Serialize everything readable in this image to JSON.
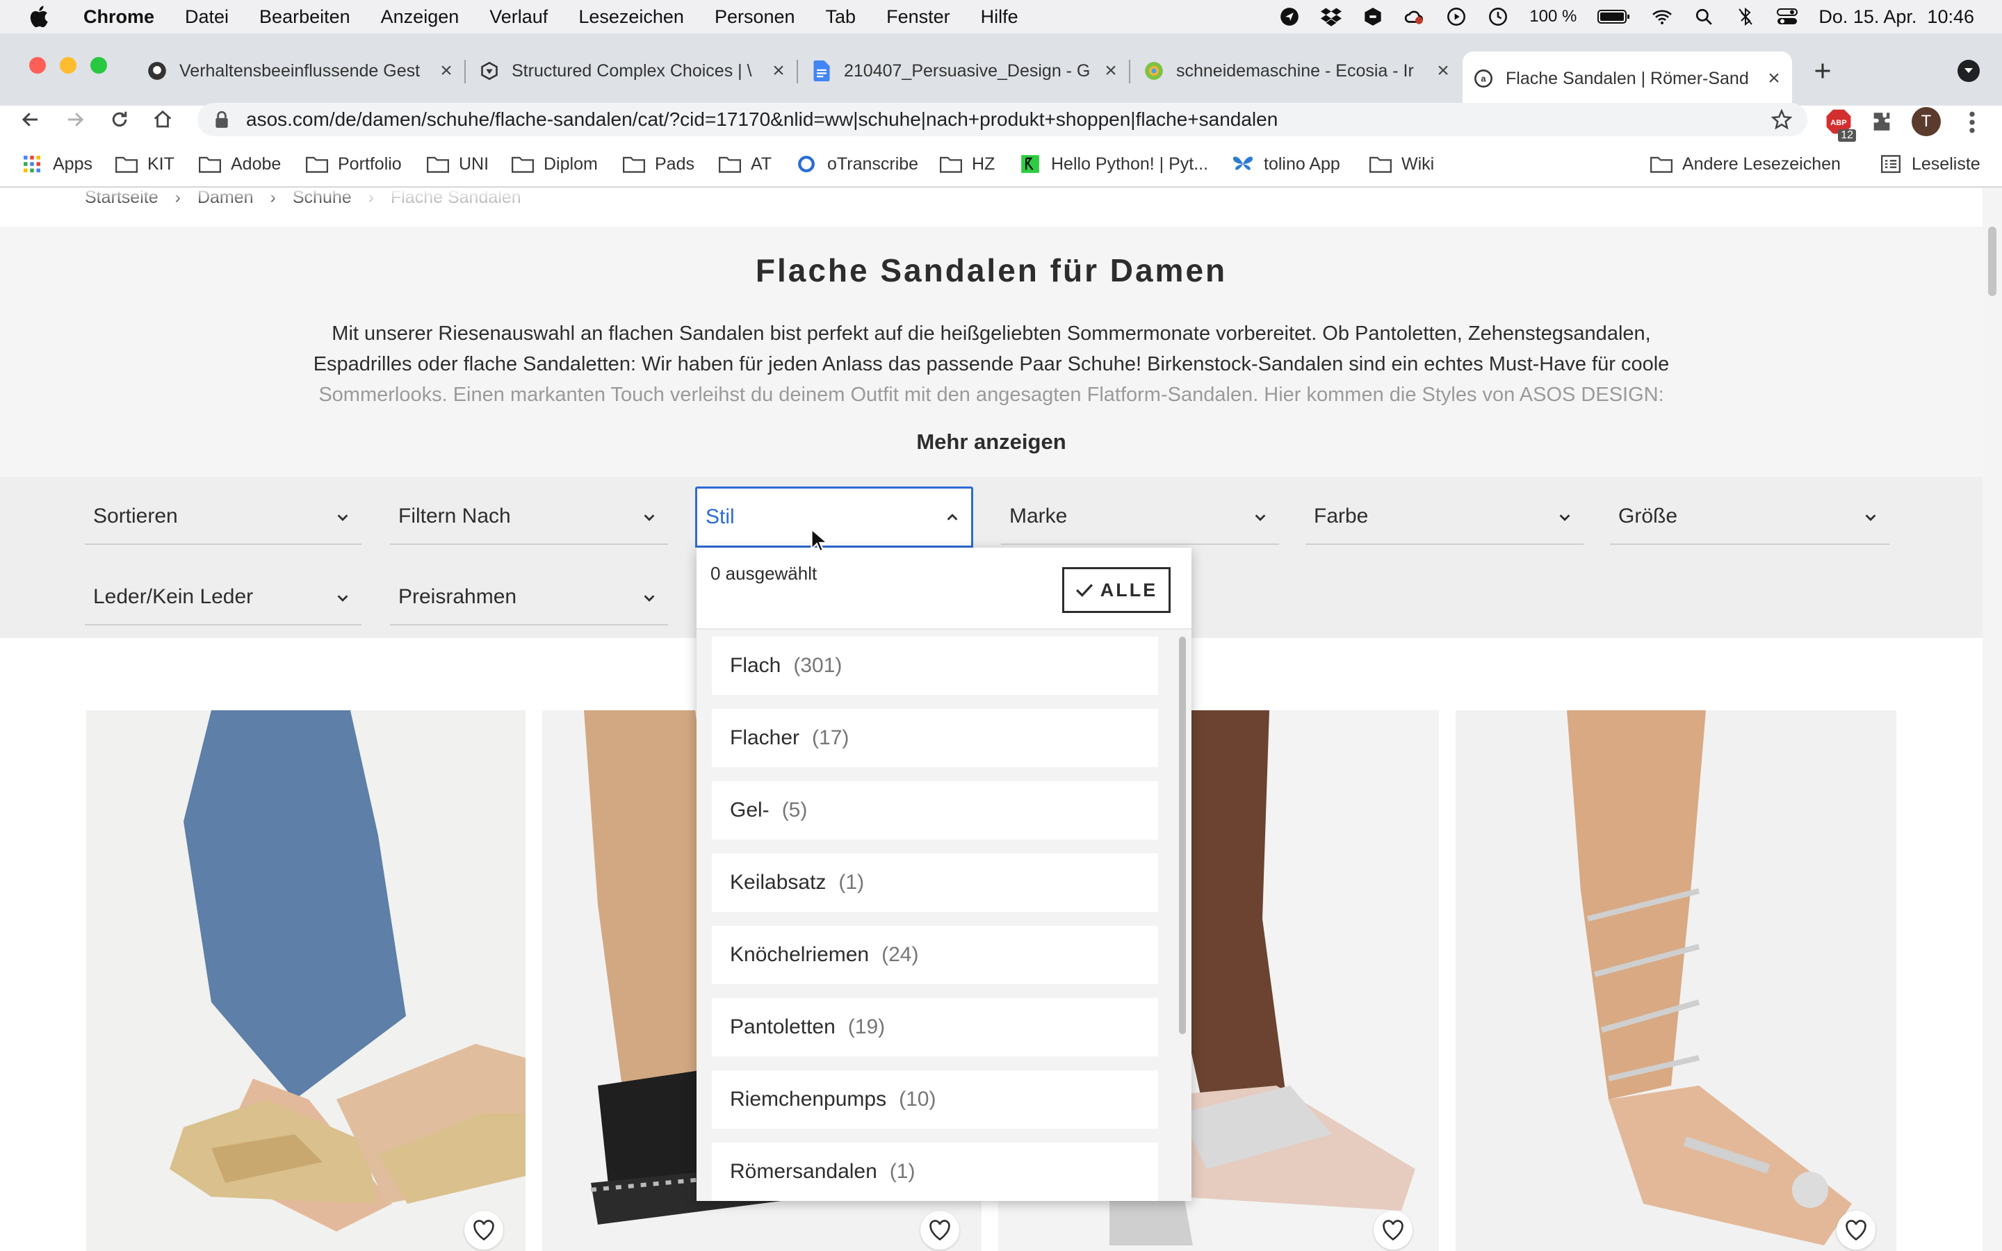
{
  "menubar": {
    "app": "Chrome",
    "items": [
      "Datei",
      "Bearbeiten",
      "Anzeigen",
      "Verlauf",
      "Lesezeichen",
      "Personen",
      "Tab",
      "Fenster",
      "Hilfe"
    ],
    "battery": "100 %",
    "datetime": "Do. 15. Apr.  10:46"
  },
  "tabs": [
    {
      "title": "Verhaltensbeeinflussende Gest",
      "icon": "github-icon"
    },
    {
      "title": "Structured Complex Choices | \\",
      "icon": "paper-icon"
    },
    {
      "title": "210407_Persuasive_Design - G",
      "icon": "docs-icon"
    },
    {
      "title": "schneidemaschine - Ecosia - Ir",
      "icon": "ecosia-icon"
    },
    {
      "title": "Flache Sandalen | Römer-Sand",
      "icon": "asos-icon",
      "active": true
    }
  ],
  "address": {
    "url": "asos.com/de/damen/schuhe/flache-sandalen/cat/?cid=17170&nlid=ww|schuhe|nach+produkt+shoppen|flache+sandalen",
    "extension_badge": "12",
    "profile_initial": "T"
  },
  "bookmarks": {
    "apps": "Apps",
    "items": [
      "KIT",
      "Adobe",
      "Portfolio",
      "UNI",
      "Diplom",
      "Pads",
      "AT",
      "oTranscribe",
      "HZ",
      "Hello Python! | Pyt...",
      "tolino App",
      "Wiki"
    ],
    "other": "Andere Lesezeichen",
    "reading_list": "Leseliste"
  },
  "breadcrumb": [
    "Startseite",
    "Damen",
    "Schuhe",
    "Flache Sandalen"
  ],
  "hero": {
    "title": "Flache Sandalen für Damen",
    "line1": "Mit unserer Riesenauswahl an flachen Sandalen bist perfekt auf die heißgeliebten Sommermonate vorbereitet. Ob Pantoletten, Zehenstegsandalen,",
    "line2": "Espadrilles oder flache Sandaletten: Wir haben für jeden Anlass das passende Paar Schuhe! Birkenstock-Sandalen sind ein echtes Must-Have für coole",
    "line3": "Sommerlooks. Einen markanten Touch verleihst du deinem Outfit mit den angesagten Flatform-Sandalen. Hier kommen die Styles von ASOS DESIGN:",
    "more": "Mehr anzeigen"
  },
  "filters": {
    "sort": "Sortieren",
    "filter_by": "Filtern Nach",
    "style": "Stil",
    "brand": "Marke",
    "color": "Farbe",
    "size": "Größe",
    "leather": "Leder/Kein Leder",
    "price": "Preisrahmen"
  },
  "dropdown": {
    "selected_count": "0 ausgewählt",
    "all_button": "ALLE",
    "options": [
      {
        "label": "Flach",
        "count": "(301)"
      },
      {
        "label": "Flacher",
        "count": "(17)"
      },
      {
        "label": "Gel-",
        "count": "(5)"
      },
      {
        "label": "Keilabsatz",
        "count": "(1)"
      },
      {
        "label": "Knöchelriemen",
        "count": "(24)"
      },
      {
        "label": "Pantoletten",
        "count": "(19)"
      },
      {
        "label": "Riemchenpumps",
        "count": "(10)"
      },
      {
        "label": "Römersandalen",
        "count": "(1)"
      }
    ]
  },
  "colors": {
    "accent": "#2d6ad6",
    "text": "#2d2d2d",
    "hero_bg": "#f5f5f5",
    "filter_bg": "#eeeeee"
  }
}
